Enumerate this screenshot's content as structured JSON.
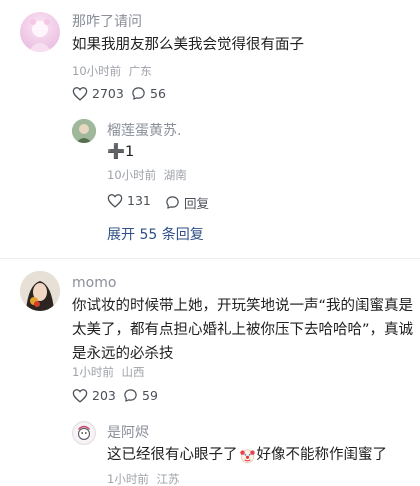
{
  "comments": [
    {
      "username": "那咋了请问",
      "text": "如果我朋友那么美我会觉得很有面子",
      "time": "10小时前",
      "location": "广东",
      "likes": "2703",
      "replies": "56",
      "sub": {
        "username": "榴莲蛋黄苏.",
        "text": "➕1",
        "time": "10小时前",
        "location": "湖南",
        "likes": "131",
        "reply_label": "回复"
      },
      "expand_label": "展开 55 条回复"
    },
    {
      "username": "momo",
      "text_lines": [
        "你试妆的时候带上她，开玩笑地说一声“我的闺蜜真是",
        "太美了，都有点担心婚礼上被你压下去哈哈哈”，真诚",
        "是永远的必杀技"
      ],
      "time": "1小时前",
      "location": "山西",
      "likes": "203",
      "replies": "59",
      "sub": {
        "username": "是阿烬",
        "text_a": "这已经很有心眼子了",
        "text_b": "好像不能称作闺蜜了",
        "time": "1小时前",
        "location": "江苏"
      }
    }
  ],
  "icons": {
    "heart": "heart-icon",
    "reply": "comment-bubble-icon",
    "clown": "clown-emoji-icon"
  }
}
